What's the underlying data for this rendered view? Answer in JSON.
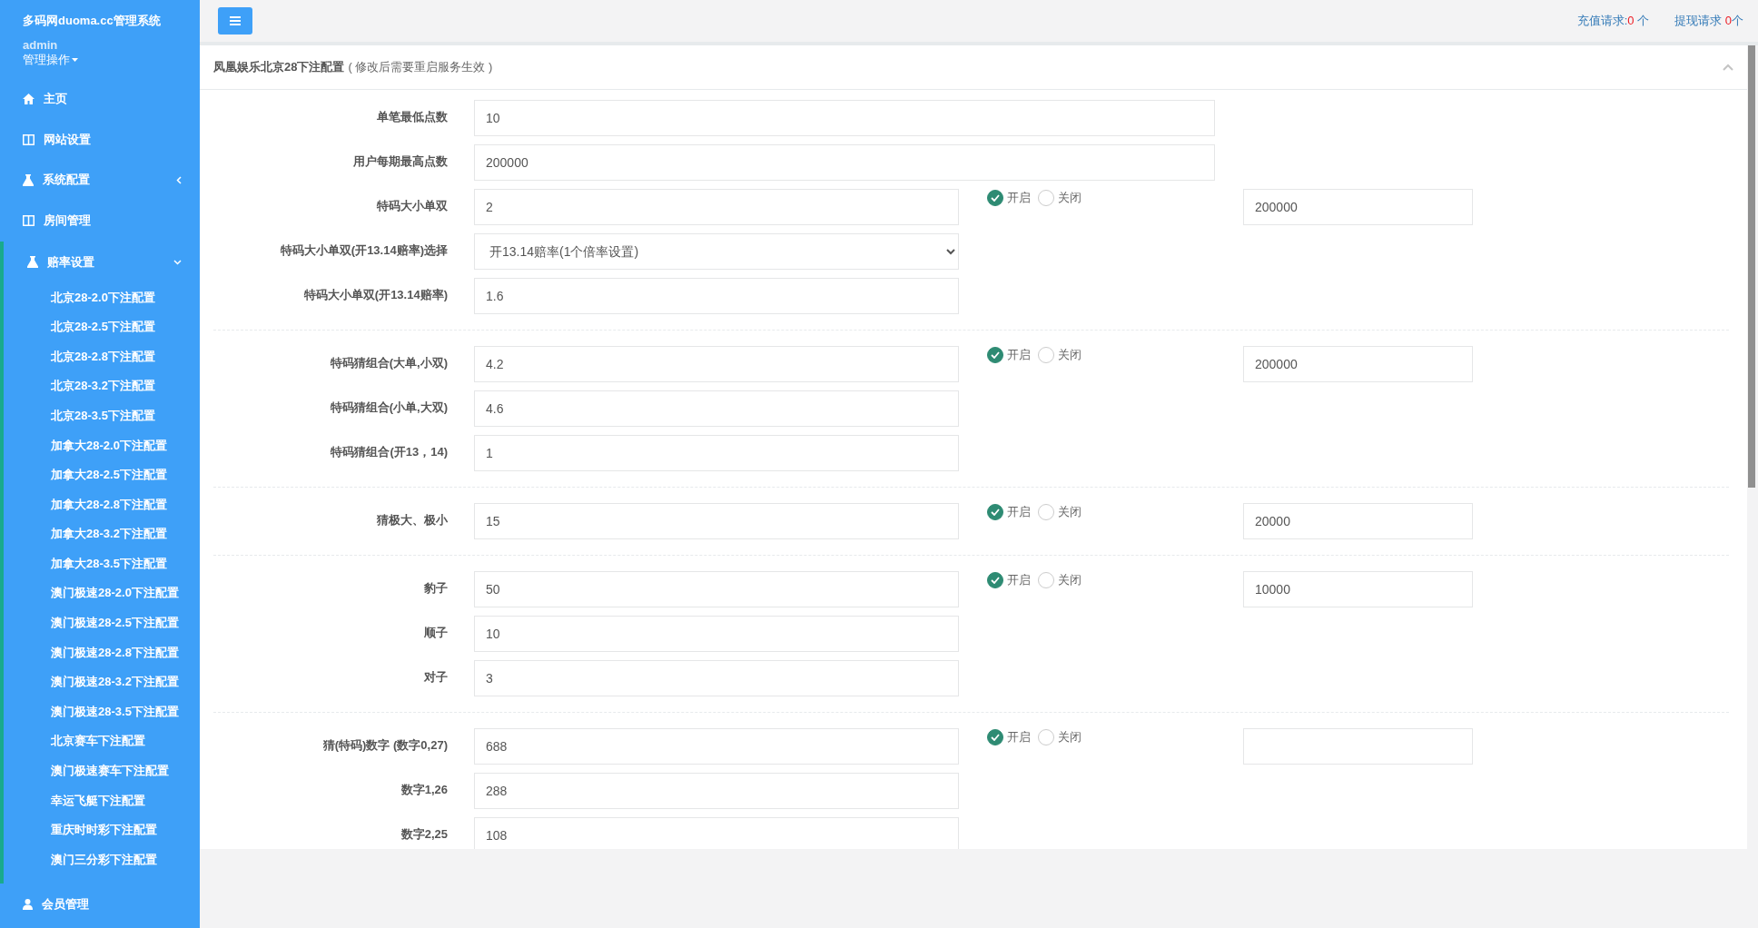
{
  "sidebar": {
    "brand": "多码网duoma.cc管理系统",
    "user": "admin",
    "user_menu": "管理操作",
    "items": [
      {
        "label": "主页",
        "expanded": false
      },
      {
        "label": "网站设置",
        "expanded": false
      },
      {
        "label": "系统配置",
        "expanded": false,
        "has_children": true
      },
      {
        "label": "房间管理",
        "expanded": false
      },
      {
        "label": "赔率设置",
        "expanded": true,
        "has_children": true,
        "children": [
          "北京28-2.0下注配置",
          "北京28-2.5下注配置",
          "北京28-2.8下注配置",
          "北京28-3.2下注配置",
          "北京28-3.5下注配置",
          "加拿大28-2.0下注配置",
          "加拿大28-2.5下注配置",
          "加拿大28-2.8下注配置",
          "加拿大28-3.2下注配置",
          "加拿大28-3.5下注配置",
          "澳门极速28-2.0下注配置",
          "澳门极速28-2.5下注配置",
          "澳门极速28-2.8下注配置",
          "澳门极速28-3.2下注配置",
          "澳门极速28-3.5下注配置",
          "北京赛车下注配置",
          "澳门极速赛车下注配置",
          "幸运飞艇下注配置",
          "重庆时时彩下注配置",
          "澳门三分彩下注配置"
        ]
      },
      {
        "label": "会员管理",
        "expanded": false
      }
    ]
  },
  "topbar": {
    "requests": [
      {
        "label": "充值请求:",
        "count": "0",
        "unit": " 个"
      },
      {
        "label": "提现请求 ",
        "count": "0",
        "unit": "个"
      }
    ]
  },
  "panel": {
    "title": "凤凰娱乐北京28下注配置",
    "note": "( 修改后需要重启服务生效 )",
    "groups": [
      [
        {
          "kind": "wide",
          "label": "单笔最低点数",
          "value": "10"
        },
        {
          "kind": "wide",
          "label": "用户每期最高点数",
          "value": "200000"
        },
        {
          "kind": "input",
          "label": "特码大小单双",
          "value": "2",
          "options": [
            {
              "label": "开启",
              "selected": true
            },
            {
              "label": "关闭",
              "selected": false
            }
          ],
          "limit": "200000"
        },
        {
          "kind": "select",
          "label": "特码大小单双(开13.14赔率)选择",
          "value": "开13.14赔率(1个倍率设置)"
        },
        {
          "kind": "input",
          "label": "特码大小单双(开13.14赔率)",
          "value": "1.6"
        }
      ],
      [
        {
          "kind": "input",
          "label": "特码猜组合(大单,小双)",
          "value": "4.2",
          "options": [
            {
              "label": "开启",
              "selected": true
            },
            {
              "label": "关闭",
              "selected": false
            }
          ],
          "limit": "200000"
        },
        {
          "kind": "input",
          "label": "特码猜组合(小单,大双)",
          "value": "4.6"
        },
        {
          "kind": "input",
          "label": "特码猜组合(开13，14)",
          "value": "1"
        }
      ],
      [
        {
          "kind": "input",
          "label": "猜极大、极小",
          "value": "15",
          "options": [
            {
              "label": "开启",
              "selected": true
            },
            {
              "label": "关闭",
              "selected": false
            }
          ],
          "limit": "20000"
        }
      ],
      [
        {
          "kind": "input",
          "label": "豹子",
          "value": "50",
          "options": [
            {
              "label": "开启",
              "selected": true
            },
            {
              "label": "关闭",
              "selected": false
            }
          ],
          "limit": "10000"
        },
        {
          "kind": "input",
          "label": "顺子",
          "value": "10"
        },
        {
          "kind": "input",
          "label": "对子",
          "value": "3"
        }
      ],
      [
        {
          "kind": "input",
          "label": "猜(特码)数字 (数字0,27)",
          "value": "688",
          "options": [
            {
              "label": "开启",
              "selected": true
            },
            {
              "label": "关闭",
              "selected": false
            }
          ],
          "limit_box": true
        },
        {
          "kind": "input",
          "label": "数字1,26",
          "value": "288"
        },
        {
          "kind": "input",
          "label": "数字2,25",
          "value": "108"
        }
      ]
    ]
  }
}
